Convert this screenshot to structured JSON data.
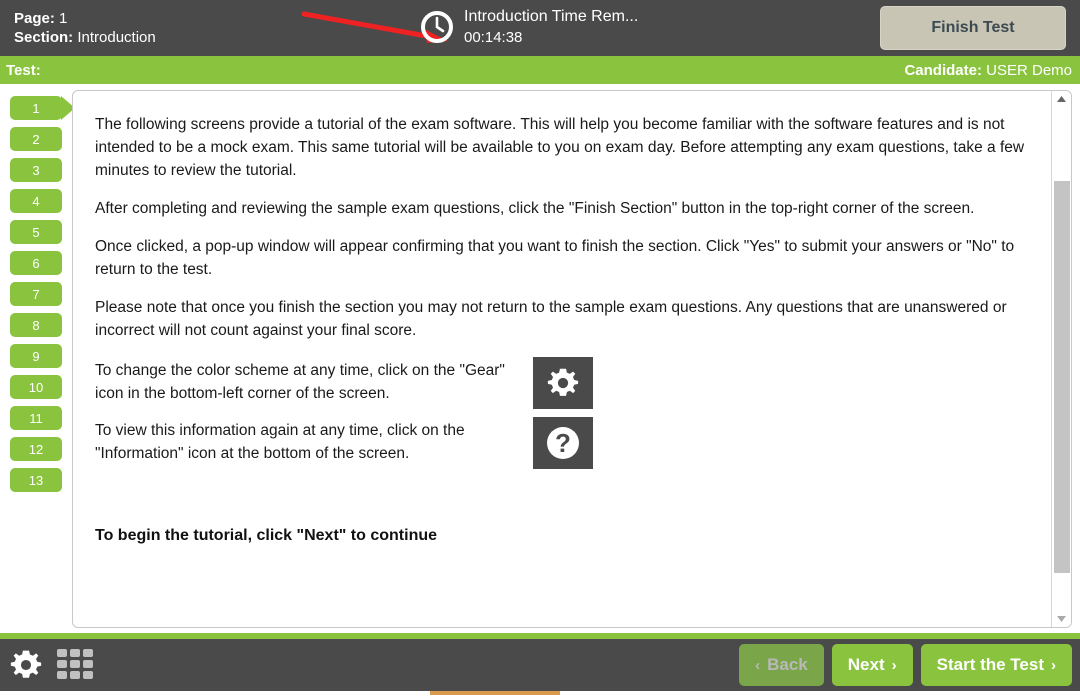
{
  "header": {
    "page_label": "Page:",
    "page_value": "1",
    "section_label": "Section:",
    "section_value": "Introduction",
    "clock_icon": "clock-icon",
    "timer_title": "Introduction Time Rem...",
    "timer_value": "00:14:38",
    "finish_test_label": "Finish Test",
    "annotation_arrow": "red-arrow-annotation"
  },
  "green_bar": {
    "test_label": "Test:",
    "test_value": "",
    "candidate_label": "Candidate:",
    "candidate_value": "USER Demo"
  },
  "sidebar": {
    "items": [
      {
        "label": "1",
        "active": true
      },
      {
        "label": "2",
        "active": false
      },
      {
        "label": "3",
        "active": false
      },
      {
        "label": "4",
        "active": false
      },
      {
        "label": "5",
        "active": false
      },
      {
        "label": "6",
        "active": false
      },
      {
        "label": "7",
        "active": false
      },
      {
        "label": "8",
        "active": false
      },
      {
        "label": "9",
        "active": false
      },
      {
        "label": "10",
        "active": false
      },
      {
        "label": "11",
        "active": false
      },
      {
        "label": "12",
        "active": false
      },
      {
        "label": "13",
        "active": false
      }
    ]
  },
  "content": {
    "paragraph_1": "The following screens provide a tutorial of the exam software. This will help you become familiar with the software features and is not intended to be a mock exam. This same tutorial will be available to you on exam day. Before attempting any exam questions, take a few minutes to review the tutorial.",
    "paragraph_2": "After completing and reviewing the sample exam questions, click the \"Finish Section\" button in the top-right corner of the screen.",
    "paragraph_3": "Once clicked, a pop-up window will appear confirming that you want to finish the section. Click \"Yes\" to submit your answers or \"No\" to return to the test.",
    "paragraph_4": "Please note that once you finish the section you may not return to the sample exam questions. Any questions that are unanswered or incorrect will not count against your final score.",
    "gear_text": "To change the color scheme at any time, click on the \"Gear\" icon in the bottom-left corner of the screen.",
    "gear_icon": "gear-icon",
    "info_text": "To view this information again at any time, click on the \"Information\" icon at the bottom of the screen.",
    "info_icon": "question-mark-icon",
    "begin_line": "To begin the tutorial, click \"Next\" to continue"
  },
  "scrollbar": {
    "up_arrow": "scroll-up-arrow",
    "down_arrow": "scroll-down-arrow"
  },
  "footer": {
    "gear_icon": "gear-icon",
    "grid_icon": "grid-icon",
    "back_label": "Back",
    "back_chevron": "‹",
    "next_label": "Next",
    "next_chevron": "›",
    "start_label": "Start the Test",
    "start_chevron": "›"
  },
  "colors": {
    "green": "#8ac43f",
    "dark": "#4a4a4a",
    "beige": "#c9c5b4",
    "annotation_red": "#ee2222"
  }
}
